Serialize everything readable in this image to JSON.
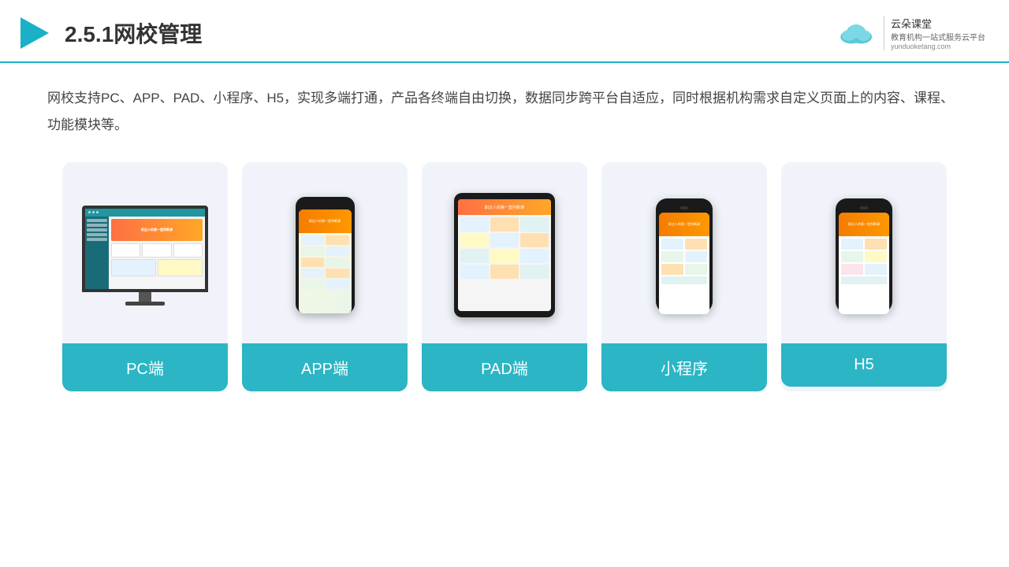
{
  "header": {
    "title": "2.5.1网校管理",
    "logo_main": "云朵课堂",
    "logo_sub": "教育机构一站",
    "logo_sub2": "式服务云平台",
    "logo_url": "yunduoketang.com"
  },
  "description": "网校支持PC、APP、PAD、小程序、H5，实现多端打通，产品各终端自由切换，数据同步跨平台自适应，同时根据机构需求自定义页面上的内容、课程、功能模块等。",
  "cards": [
    {
      "id": "pc",
      "label": "PC端",
      "type": "pc"
    },
    {
      "id": "app",
      "label": "APP端",
      "type": "phone"
    },
    {
      "id": "pad",
      "label": "PAD端",
      "type": "tablet"
    },
    {
      "id": "miniapp",
      "label": "小程序",
      "type": "phone-mini"
    },
    {
      "id": "h5",
      "label": "H5",
      "type": "phone-mini2"
    }
  ],
  "accent_color": "#2bb5c5"
}
